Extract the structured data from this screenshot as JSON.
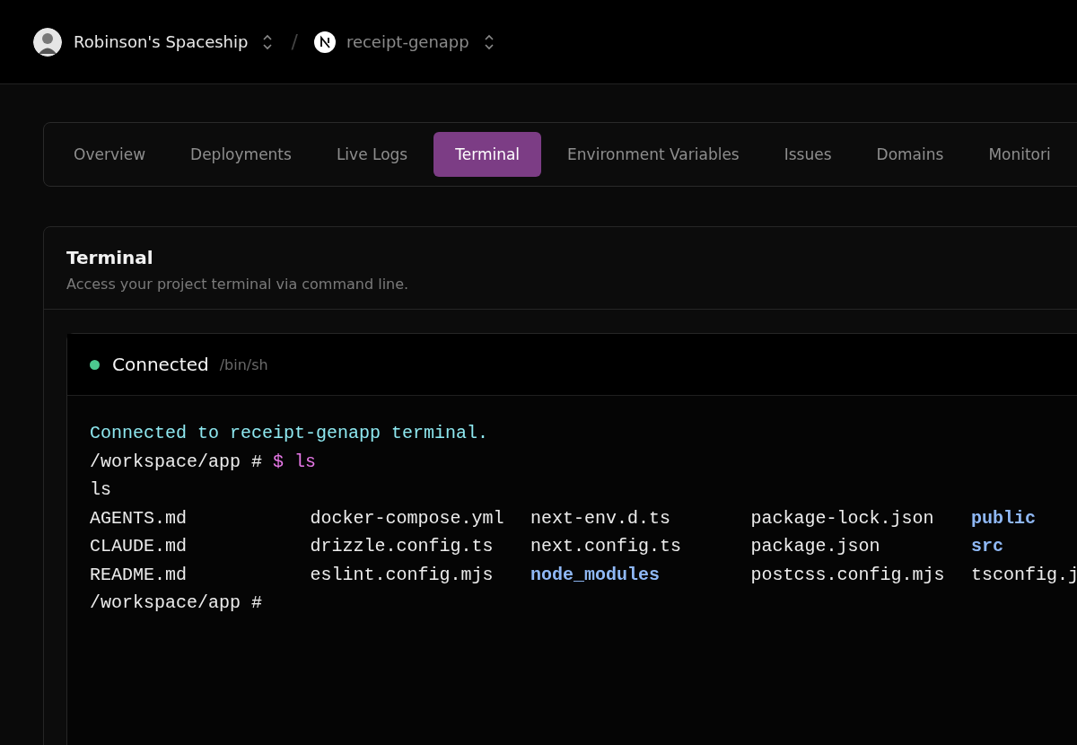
{
  "header": {
    "team": "Robinson's Spaceship",
    "project": "receipt-genapp",
    "separator": "/"
  },
  "tabs": [
    {
      "label": "Overview",
      "selected": false
    },
    {
      "label": "Deployments",
      "selected": false
    },
    {
      "label": "Live Logs",
      "selected": false
    },
    {
      "label": "Terminal",
      "selected": true
    },
    {
      "label": "Environment Variables",
      "selected": false
    },
    {
      "label": "Issues",
      "selected": false
    },
    {
      "label": "Domains",
      "selected": false
    },
    {
      "label": "Monitori",
      "selected": false
    }
  ],
  "panel": {
    "title": "Terminal",
    "subtitle": "Access your project terminal via command line."
  },
  "terminal": {
    "connected": true,
    "status": "Connected",
    "shell": "/bin/sh",
    "lines": [
      {
        "kind": "info",
        "text": "Connected to receipt-genapp terminal."
      },
      {
        "kind": "prompt",
        "path": "/workspace/app #",
        "command": "$ ls"
      },
      {
        "kind": "output",
        "text": "ls"
      },
      {
        "kind": "listing",
        "entries": [
          {
            "name": "AGENTS.md",
            "dir": false
          },
          {
            "name": "docker-compose.yml",
            "dir": false
          },
          {
            "name": "next-env.d.ts",
            "dir": false
          },
          {
            "name": "package-lock.json",
            "dir": false
          },
          {
            "name": "public",
            "dir": true
          }
        ]
      },
      {
        "kind": "listing",
        "entries": [
          {
            "name": "CLAUDE.md",
            "dir": false
          },
          {
            "name": "drizzle.config.ts",
            "dir": false
          },
          {
            "name": "next.config.ts",
            "dir": false
          },
          {
            "name": "package.json",
            "dir": false
          },
          {
            "name": "src",
            "dir": true
          }
        ]
      },
      {
        "kind": "listing",
        "entries": [
          {
            "name": "README.md",
            "dir": false
          },
          {
            "name": "eslint.config.mjs",
            "dir": false
          },
          {
            "name": "node_modules",
            "dir": true
          },
          {
            "name": "postcss.config.mjs",
            "dir": false
          },
          {
            "name": "tsconfig.j",
            "dir": false
          }
        ]
      },
      {
        "kind": "prompt",
        "path": "/workspace/app #"
      }
    ]
  }
}
